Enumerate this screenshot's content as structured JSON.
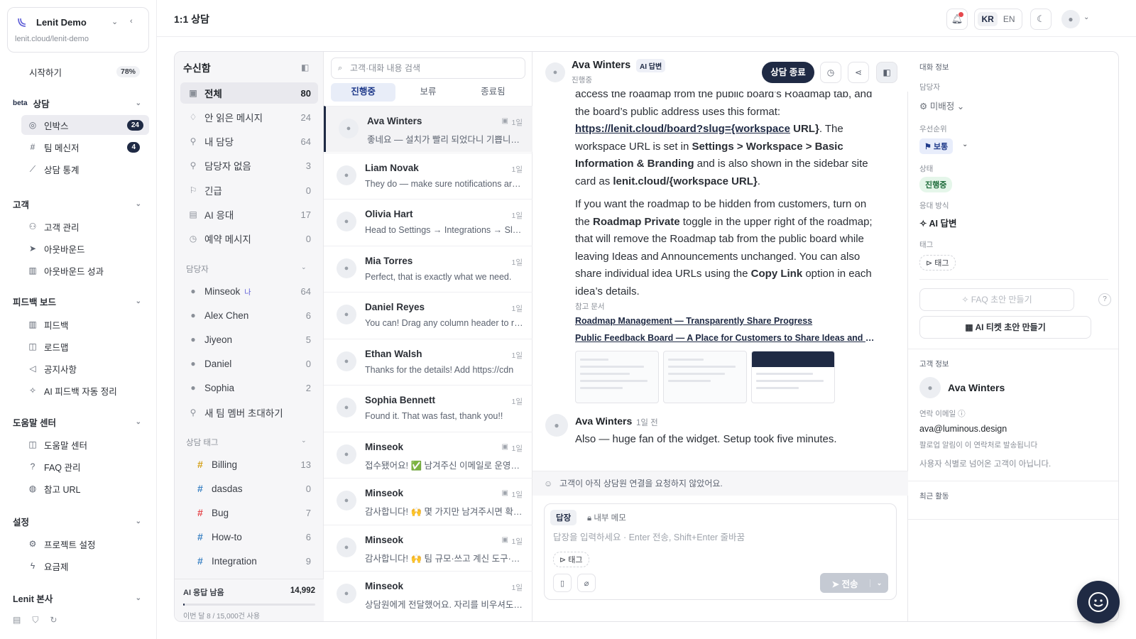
{
  "project": {
    "name": "Lenit Demo",
    "url": "lenit.cloud/lenit-demo"
  },
  "sidebar": {
    "start": {
      "label": "시작하기",
      "progress": "78%"
    },
    "sections": [
      {
        "title": "상담",
        "beta": "beta",
        "items": [
          {
            "label": "인박스",
            "count": "24",
            "icon": "inbox-icon"
          },
          {
            "label": "팀 메신저",
            "count": "4",
            "icon": "hash-icon"
          },
          {
            "label": "상담 통계",
            "icon": "chart-icon"
          }
        ]
      },
      {
        "title": "고객",
        "items": [
          {
            "label": "고객 관리",
            "icon": "users-icon"
          },
          {
            "label": "아웃바운드",
            "icon": "send-icon"
          },
          {
            "label": "아웃바운드 성과",
            "icon": "bar-chart-icon"
          }
        ]
      },
      {
        "title": "피드백 보드",
        "items": [
          {
            "label": "피드백",
            "icon": "bar-chart-icon"
          },
          {
            "label": "로드맵",
            "icon": "map-icon"
          },
          {
            "label": "공지사항",
            "icon": "megaphone-icon"
          },
          {
            "label": "AI 피드백 자동 정리",
            "icon": "sparkle-icon"
          }
        ]
      },
      {
        "title": "도움말 센터",
        "items": [
          {
            "label": "도움말 센터",
            "icon": "book-icon"
          },
          {
            "label": "FAQ 관리",
            "icon": "question-icon"
          },
          {
            "label": "참고 URL",
            "icon": "globe-icon"
          }
        ]
      },
      {
        "title": "설정",
        "items": [
          {
            "label": "프로젝트 설정",
            "icon": "gear-icon"
          },
          {
            "label": "요금제",
            "icon": "bolt-icon"
          }
        ]
      },
      {
        "title": "Lenit 본사",
        "items": []
      }
    ]
  },
  "header": {
    "title": "1:1 상담",
    "lang_kr": "KR",
    "lang_en": "EN"
  },
  "folders": {
    "title": "수신함",
    "items": [
      {
        "label": "전체",
        "count": "80"
      },
      {
        "label": "안 읽은 메시지",
        "count": "24"
      },
      {
        "label": "내 담당",
        "count": "64"
      },
      {
        "label": "담당자 없음",
        "count": "3"
      },
      {
        "label": "긴급",
        "count": "0"
      },
      {
        "label": "AI 응대",
        "count": "17"
      },
      {
        "label": "예약 메시지",
        "count": "0"
      }
    ],
    "assignee_title": "담당자",
    "assignees": [
      {
        "label": "Minseok",
        "mine": "나",
        "count": "64"
      },
      {
        "label": "Alex Chen",
        "count": "6"
      },
      {
        "label": "Jiyeon",
        "count": "5"
      },
      {
        "label": "Daniel",
        "count": "0"
      },
      {
        "label": "Sophia",
        "count": "2"
      }
    ],
    "invite": "새 팀 멤버 초대하기",
    "tags_title": "상담 태그",
    "tags": [
      {
        "label": "Billing",
        "count": "13",
        "color": "#d4a017"
      },
      {
        "label": "dasdas",
        "count": "0",
        "color": "#3b82c4"
      },
      {
        "label": "Bug",
        "count": "7",
        "color": "#e5484d"
      },
      {
        "label": "How-to",
        "count": "6",
        "color": "#3b82c4"
      },
      {
        "label": "Integration",
        "count": "9",
        "color": "#3b82c4"
      }
    ],
    "usage": {
      "title": "AI 응답 남음",
      "value": "14,992",
      "sub": "이번 달 8 / 15,000건 사용",
      "fraction": 0.0005
    }
  },
  "conversations": {
    "search_placeholder": "고객·대화 내용 검색",
    "tabs": [
      "진행중",
      "보류",
      "종료됨"
    ],
    "items": [
      {
        "name": "Ava Winters",
        "time": "1일",
        "preview": "좋네요 — 설치가 빨리 되었다니 기쁩니다. 더 궁금한 점이 있으시면",
        "inbox": true
      },
      {
        "name": "Liam Novak",
        "time": "1일",
        "preview": "They do — make sure notifications are on",
        "inbox": false
      },
      {
        "name": "Olivia Hart",
        "time": "1일",
        "preview": "Head to Settings → Integrations → Slack",
        "inbox": false
      },
      {
        "name": "Mia Torres",
        "time": "1일",
        "preview": "Perfect, that is exactly what we need.",
        "inbox": false
      },
      {
        "name": "Daniel Reyes",
        "time": "1일",
        "preview": "You can! Drag any column header to reorder",
        "inbox": false
      },
      {
        "name": "Ethan Walsh",
        "time": "1일",
        "preview": "Thanks for the details! Add https://cdn",
        "inbox": false
      },
      {
        "name": "Sophia Bennett",
        "time": "1일",
        "preview": "Found it. That was fast, thank you!!",
        "inbox": false
      },
      {
        "name": "Minseok",
        "time": "1일",
        "preview": "접수됐어요! ✅ 남겨주신 이메일로 운영진이 연락드릴게요",
        "inbox": true
      },
      {
        "name": "Minseok",
        "time": "1일",
        "preview": "감사합니다! 🙌 몇 가지만 남겨주시면 확인 후 안내드릴게요",
        "inbox": true
      },
      {
        "name": "Minseok",
        "time": "1일",
        "preview": "감사합니다! 🙌 팀 규모·쓰고 계신 도구·궁금한 점을 알려주세요",
        "inbox": true
      },
      {
        "name": "Minseok",
        "time": "1일",
        "preview": "상담원에게 전달했어요. 자리를 비우셔도 답변은 이메일로 드릴게요",
        "inbox": false
      }
    ]
  },
  "chat": {
    "name": "Ava Winters",
    "badge": "AI 답변",
    "status": "진행중",
    "end_label": "상담 종료",
    "p1_a": "access the roadmap from the public board’s Roadmap tab, and the board’s public address uses this format: ",
    "p1_link": "https://lenit.cloud/board?slug={workspace",
    "p1_b": " URL}",
    "p1_c": ". The workspace URL is set in ",
    "p1_d": "Settings > Workspace > Basic Information & Branding",
    "p1_e": " and is also shown in the sidebar site card as ",
    "p1_f": "lenit.cloud/{workspace URL}",
    "p1_g": ".",
    "p2_a": "If you want the roadmap to be hidden from customers, turn on the ",
    "p2_b": "Roadmap Private",
    "p2_c": " toggle in the upper right of the roadmap; that will remove the Roadmap tab from the public board while leaving Ideas and Announcements unchanged. You can also share individual idea URLs using the ",
    "p2_d": "Copy Link",
    "p2_e": " option in each idea’s details.",
    "refs_title": "참고 문서",
    "refs": [
      "Roadmap Management — Transparently Share Progress",
      "Public Feedback Board — A Place for Customers to Share Ideas and Vote"
    ],
    "msg2": {
      "name": "Ava Winters",
      "time": "1일 전",
      "text": "Also — huge fan of the widget. Setup took five minutes."
    },
    "notice": "고객이 아직 상담원 연결을 요청하지 않았어요.",
    "composer": {
      "reply_tab": "답장",
      "memo_tab": "내부 메모",
      "placeholder": "답장을 입력하세요 · Enter 전송, Shift+Enter 줄바꿈",
      "tag": "태그",
      "send": "전송"
    }
  },
  "info": {
    "section": "대화 정보",
    "assignee_label": "담당자",
    "assignee_value": "미배정",
    "priority_label": "우선순위",
    "priority_value": "보통",
    "status_label": "상태",
    "status_value": "진행중",
    "mode_label": "응대 방식",
    "mode_value": "AI 답변",
    "tag_label": "태그",
    "tag_value": "태그",
    "faq_btn": "FAQ 초안 만들기",
    "ticket_btn": "AI 티켓 초안 만들기",
    "customer_section": "고객 정보",
    "customer_name": "Ava Winters",
    "email_label": "연락 이메일",
    "email_value": "ava@luminous.design",
    "email_note": "팔로업 알림이 이 연락처로 발송됩니다",
    "ident_note": "사용자 식별로 넘어온 고객이 아닙니다.",
    "activity_label": "최근 활동"
  }
}
